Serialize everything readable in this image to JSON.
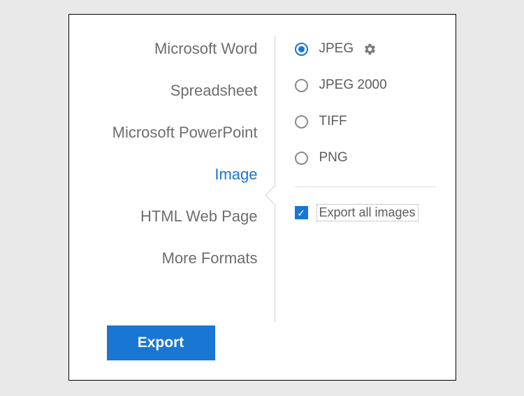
{
  "formats": {
    "word": "Microsoft Word",
    "spreadsheet": "Spreadsheet",
    "powerpoint": "Microsoft PowerPoint",
    "image": "Image",
    "html": "HTML Web Page",
    "more": "More Formats"
  },
  "image_options": {
    "jpeg": "JPEG",
    "jpeg2000": "JPEG 2000",
    "tiff": "TIFF",
    "png": "PNG"
  },
  "export_all_label": "Export all images",
  "export_button": "Export"
}
